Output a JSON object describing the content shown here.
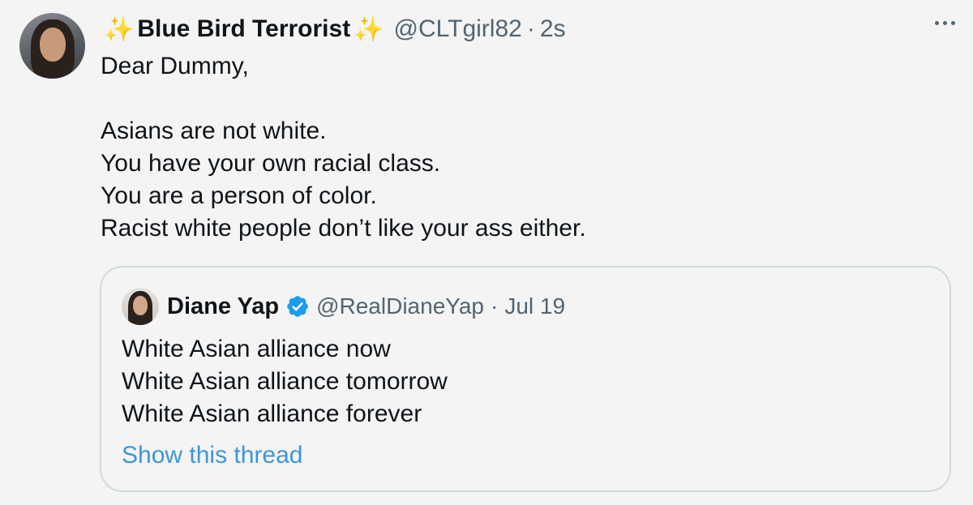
{
  "tweet": {
    "author": {
      "sparkle_left": "✨",
      "display_name": "Blue Bird Terrorist",
      "sparkle_right": "✨",
      "handle": "@CLTgirl82",
      "separator": "·",
      "time": "2s",
      "avatar_icon": "profile-photo"
    },
    "more_icon": "more-horizontal-icon",
    "lines": [
      "Dear Dummy,",
      "",
      "Asians are not white.",
      "You have your own racial class.",
      "You are a person of color.",
      "Racist white people don’t like your ass either."
    ]
  },
  "quoted": {
    "author": {
      "display_name": "Diane Yap",
      "verified_icon": "verified-badge-icon",
      "handle": "@RealDianeYap",
      "separator": "·",
      "time": "Jul 19"
    },
    "lines": [
      "White Asian alliance now",
      "White Asian alliance tomorrow",
      "White Asian alliance forever"
    ],
    "show_thread_label": "Show this thread"
  },
  "colors": {
    "background": "#f4f4f4",
    "text": "#0f1419",
    "secondary_text": "#536471",
    "link": "#3f95d9",
    "verified_blue": "#1d9bf0",
    "border": "#cfd9de"
  }
}
